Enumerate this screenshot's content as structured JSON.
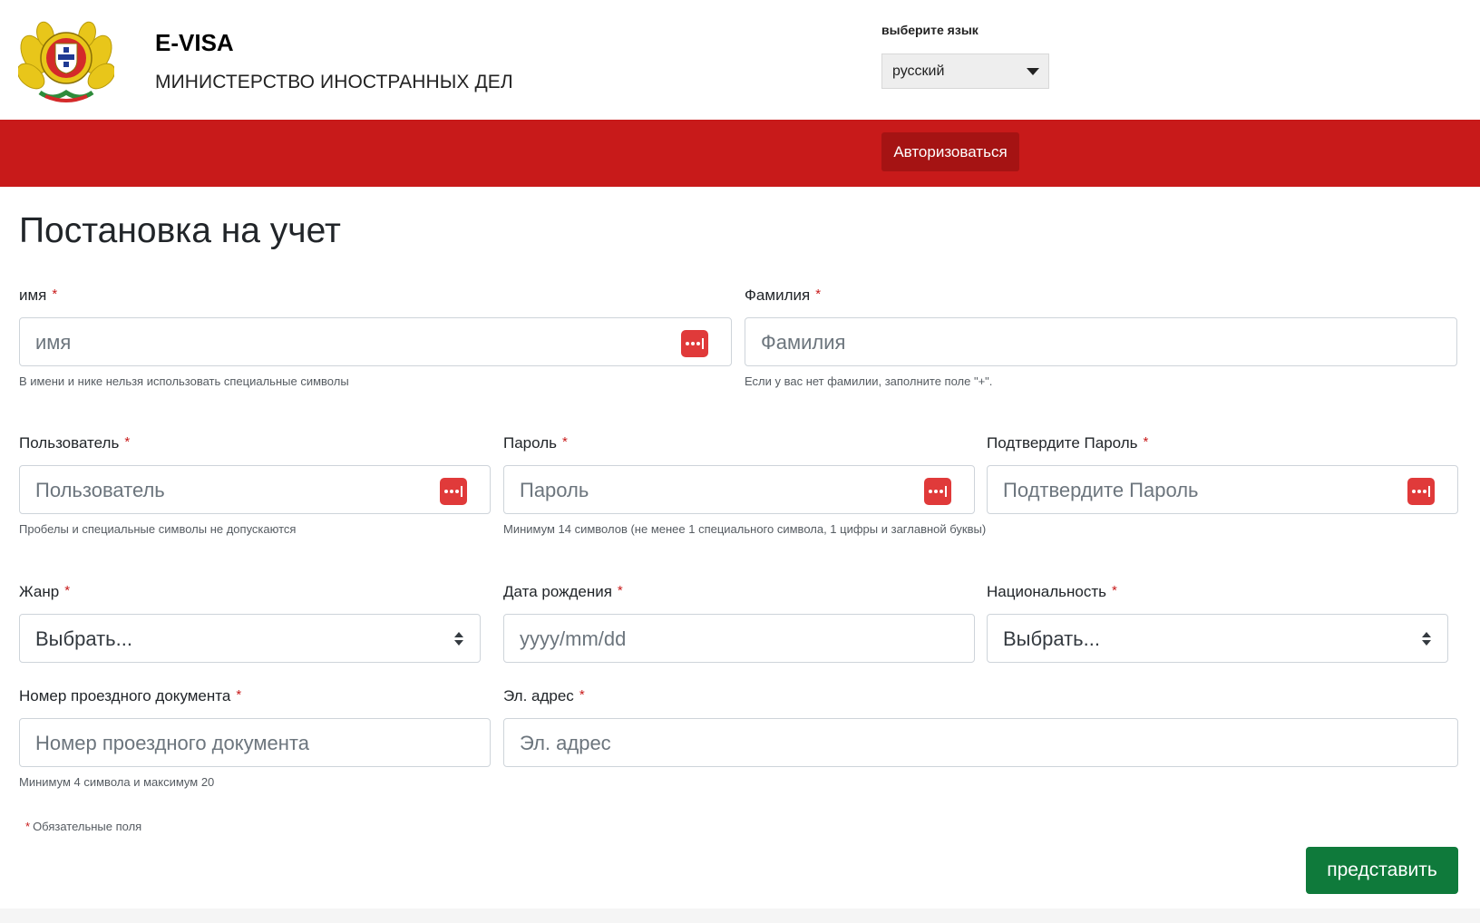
{
  "header": {
    "title": "E-VISA",
    "subtitle": "МИНИСТЕРСТВО ИНОСТРАННЫХ ДЕЛ",
    "language_label": "выберите язык",
    "language_value": "русский"
  },
  "nav": {
    "login_label": "Авторизоваться"
  },
  "page": {
    "title": "Постановка на учет"
  },
  "form": {
    "required_mark": "*",
    "first_name": {
      "label": "имя",
      "placeholder": "имя",
      "help": "В имени и нике нельзя использовать специальные символы"
    },
    "last_name": {
      "label": "Фамилия",
      "placeholder": "Фамилия",
      "help": "Если у вас нет фамилии, заполните поле \"+\"."
    },
    "username": {
      "label": "Пользователь",
      "placeholder": "Пользователь",
      "help": "Пробелы и специальные символы не допускаются"
    },
    "password": {
      "label": "Пароль",
      "placeholder": "Пароль",
      "help": "Минимум 14 символов (не менее 1 специального символа, 1 цифры и заглавной буквы)"
    },
    "confirm_password": {
      "label": "Подтвердите Пароль",
      "placeholder": "Подтвердите Пароль"
    },
    "gender": {
      "label": "Жанр",
      "value": "Выбрать..."
    },
    "birth_date": {
      "label": "Дата рождения",
      "placeholder": "yyyy/mm/dd"
    },
    "nationality": {
      "label": "Национальность",
      "value": "Выбрать..."
    },
    "passport": {
      "label": "Номер проездного документа",
      "placeholder": "Номер проездного документа",
      "help": "Минимум 4 символа и максимум 20"
    },
    "email": {
      "label": "Эл. адрес",
      "placeholder": "Эл. адрес"
    },
    "required_note": "Обязательные поля",
    "submit_label": "представить"
  },
  "colors": {
    "brand_red": "#c81a1a",
    "submit_green": "#0f7a3b",
    "icon_red": "#e03a3a"
  }
}
